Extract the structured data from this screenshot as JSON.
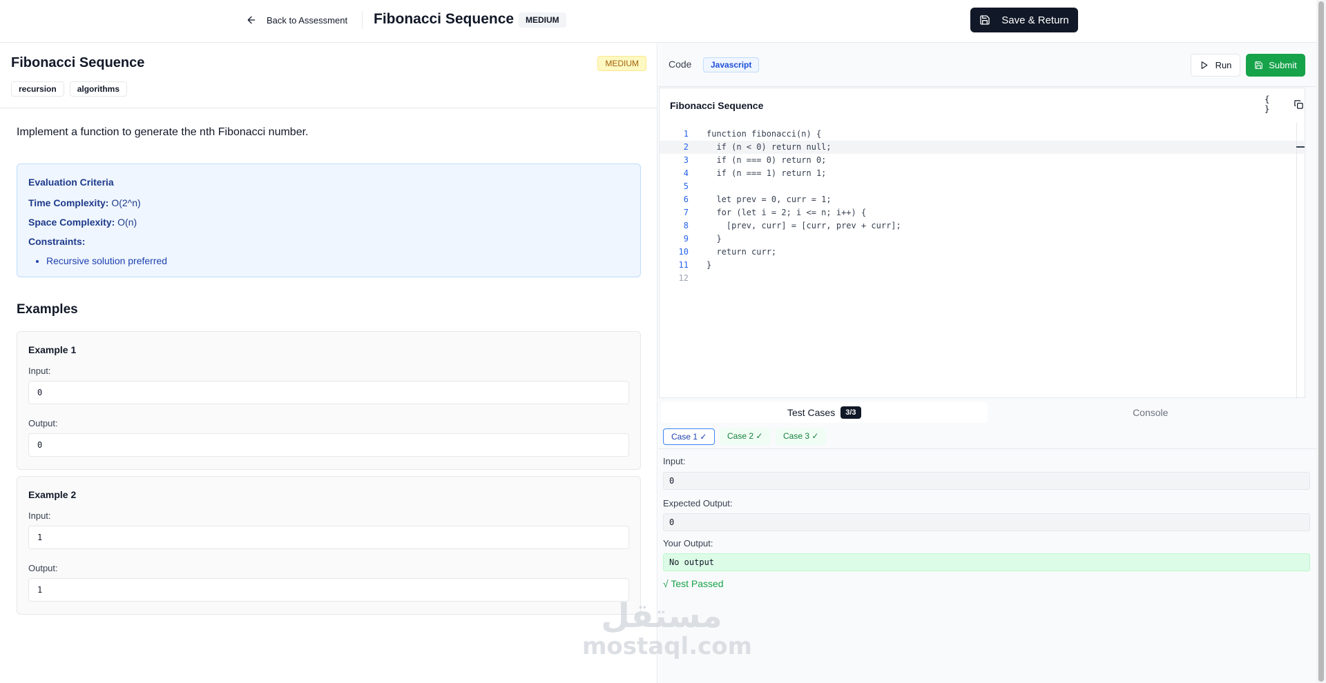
{
  "header": {
    "back_label": "Back to Assessment",
    "title": "Fibonacci Sequence",
    "difficulty": "MEDIUM",
    "save_label": "Save & Return"
  },
  "problem": {
    "title": "Fibonacci Sequence",
    "difficulty": "MEDIUM",
    "tags": [
      "recursion",
      "algorithms"
    ],
    "description": "Implement a function to generate the nth Fibonacci number.",
    "criteria": {
      "heading": "Evaluation Criteria",
      "time_label": "Time Complexity:",
      "time_value": "O(2^n)",
      "space_label": "Space Complexity:",
      "space_value": "O(n)",
      "constraints_label": "Constraints:",
      "constraints": [
        "Recursive solution preferred"
      ]
    },
    "examples_heading": "Examples",
    "examples": [
      {
        "title": "Example 1",
        "input_label": "Input:",
        "input": "0",
        "output_label": "Output:",
        "output": "0"
      },
      {
        "title": "Example 2",
        "input_label": "Input:",
        "input": "1",
        "output_label": "Output:",
        "output": "1"
      }
    ]
  },
  "editor": {
    "code_label": "Code",
    "language": "Javascript",
    "run_label": "Run",
    "submit_label": "Submit",
    "file_title": "Fibonacci Sequence",
    "format_icon": "{ }",
    "active_line": 2,
    "lines": [
      "function fibonacci(n) {",
      "  if (n < 0) return null;",
      "  if (n === 0) return 0;",
      "  if (n === 1) return 1;",
      "",
      "  let prev = 0, curr = 1;",
      "  for (let i = 2; i <= n; i++) {",
      "    [prev, curr] = [curr, prev + curr];",
      "  }",
      "  return curr;",
      "}",
      ""
    ]
  },
  "tests": {
    "tab_label": "Test Cases",
    "count": "3/3",
    "console_label": "Console",
    "cases": [
      "Case 1 ✓",
      "Case 2 ✓",
      "Case 3 ✓"
    ],
    "selected_case": 0,
    "input_label": "Input:",
    "input": "0",
    "expected_label": "Expected Output:",
    "expected": "0",
    "your_label": "Your Output:",
    "your_output": "No output",
    "status": "√ Test Passed"
  },
  "watermark": {
    "arabic": "مستقل",
    "latin": "mostaql.com"
  }
}
